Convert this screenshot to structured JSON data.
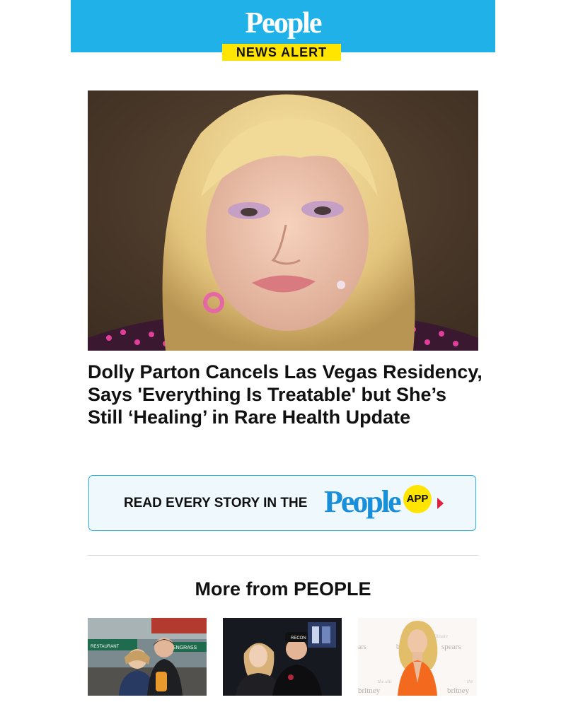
{
  "header": {
    "logo_text": "People",
    "alert_label": "NEWS ALERT",
    "background_color": "#1fb1e8",
    "badge_color": "#ffe500"
  },
  "article": {
    "headline": "Dolly Parton Cancels Las Vegas Residency, Says 'Everything Is Treatable' but She’s Still ‘Healing’ in Rare Health Update"
  },
  "app_banner": {
    "text": "READ EVERY STORY IN THE",
    "logo_text": "People",
    "badge_text": "APP",
    "border_color": "#2aaee5",
    "arrow_color": "#e0203a"
  },
  "more_section": {
    "title": "More from PEOPLE",
    "thumbnails": [
      {
        "signage_left": "RESTAURANT",
        "signage_right": "ENGRASS"
      },
      {
        "cap_text": "RECON"
      },
      {
        "backdrop_words": [
          "ars",
          "b",
          "ultimate",
          "spears",
          "the ulti",
          "britney",
          "the",
          "britney"
        ]
      }
    ]
  }
}
